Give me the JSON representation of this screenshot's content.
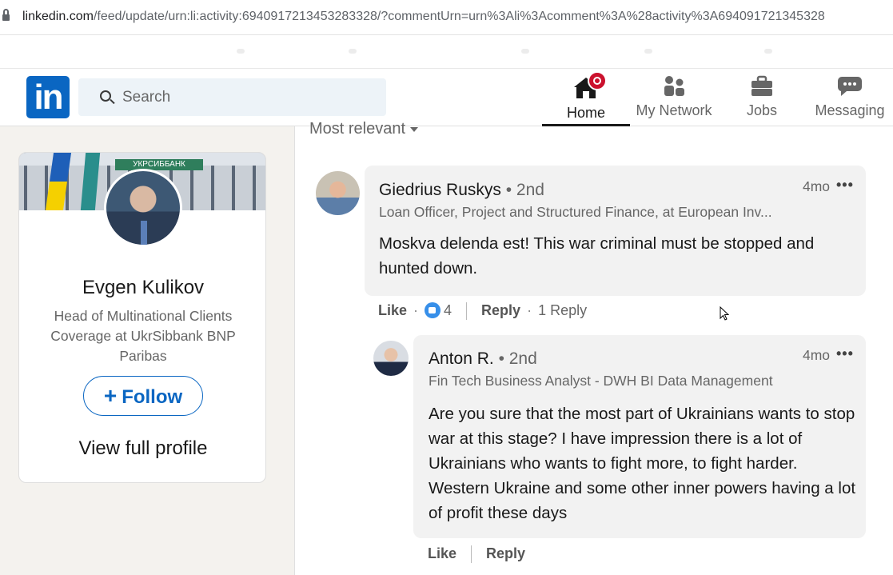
{
  "browser": {
    "url_host": "linkedin.com",
    "url_path": "/feed/update/urn:li:activity:6940917213453283328/?commentUrn=urn%3Ali%3Acomment%3A%28activity%3A694091721345328"
  },
  "nav": {
    "logo": "in",
    "search_placeholder": "Search",
    "items": [
      {
        "label": "Home",
        "icon": "home-icon"
      },
      {
        "label": "My Network",
        "icon": "network-icon"
      },
      {
        "label": "Jobs",
        "icon": "briefcase-icon"
      },
      {
        "label": "Messaging",
        "icon": "messaging-icon"
      }
    ]
  },
  "profile": {
    "cover_sign": "УКРСИББАНК",
    "name": "Evgen Kulikov",
    "title": "Head of Multinational Clients Coverage at UkrSibbank BNP Paribas",
    "follow_label": "Follow",
    "view_profile_label": "View full profile"
  },
  "sort": {
    "label": "Most relevant"
  },
  "comments": [
    {
      "name": "Giedrius Ruskys",
      "degree": "• 2nd",
      "headline": "Loan Officer, Project and Structured Finance, at European Inv...",
      "time": "4mo",
      "more": "•••",
      "text": "Moskva delenda est! This war criminal must be stopped and hunted down.",
      "actions": {
        "like": "Like",
        "like_count": "4",
        "reply": "Reply",
        "replies": "1 Reply"
      }
    },
    {
      "name": "Anton R.",
      "degree": "• 2nd",
      "headline": "Fin Tech Business Analyst - DWH BI Data Management",
      "time": "4mo",
      "more": "•••",
      "text": "Are you sure that the most part of Ukrainians wants to stop war at this stage? I have impression there is a lot of Ukrainians who wants to fight more, to fight harder. Western Ukraine and some other inner powers having a lot of profit these days",
      "actions": {
        "like": "Like",
        "reply": "Reply"
      }
    }
  ],
  "colors": {
    "brand": "#0a66c2",
    "notification": "#cb112d",
    "reaction": "#378fe9"
  }
}
